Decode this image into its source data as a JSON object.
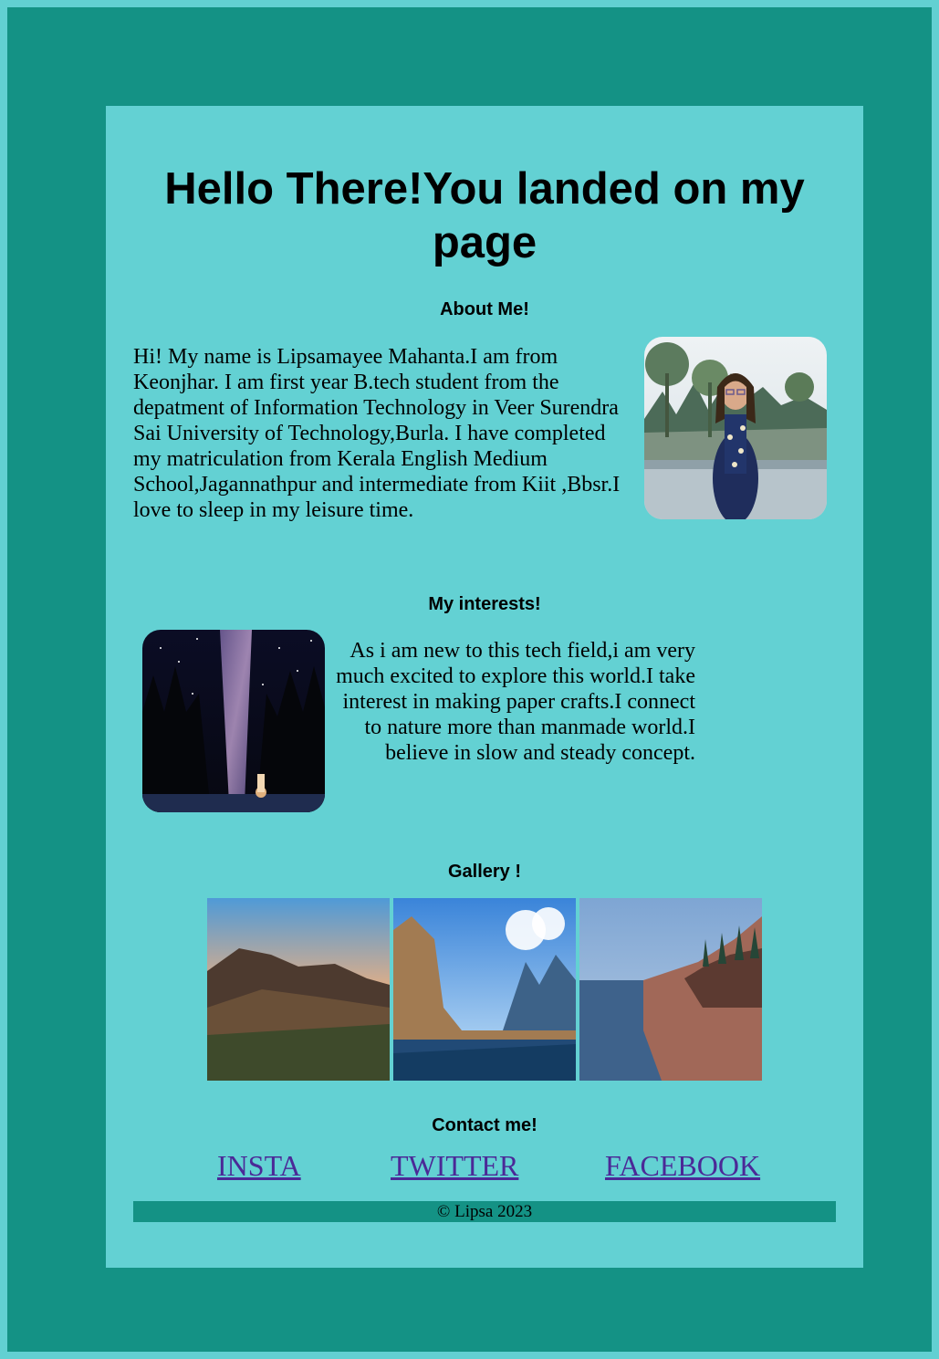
{
  "header": {
    "title": "Hello There!You landed on my page"
  },
  "about": {
    "heading": "About Me!",
    "text": "Hi! My name is Lipsamayee Mahanta.I am from Keonjhar. I am first year B.tech student from the depatment of Information Technology in Veer Surendra Sai University of Technology,Burla. I have completed my matriculation from Kerala English Medium School,Jagannathpur and intermediate from Kiit ,Bbsr.I love to sleep in my leisure time."
  },
  "interests": {
    "heading": "My interests!",
    "text": "As i am new to this tech field,i am very much excited to explore this world.I take interest in making paper crafts.I connect to nature more than manmade world.I believe in slow and steady concept."
  },
  "gallery": {
    "heading": "Gallery !"
  },
  "contact": {
    "heading": "Contact me!",
    "links": [
      "INSTA",
      "TWITTER",
      "FACEBOOK"
    ]
  },
  "footer": {
    "text": "© Lipsa 2023"
  },
  "colors": {
    "page_background": "#149285",
    "card_background": "#63d1d3",
    "frame_border": "#62d0d2",
    "link": "#4b2997",
    "footer_bar": "#149285"
  }
}
